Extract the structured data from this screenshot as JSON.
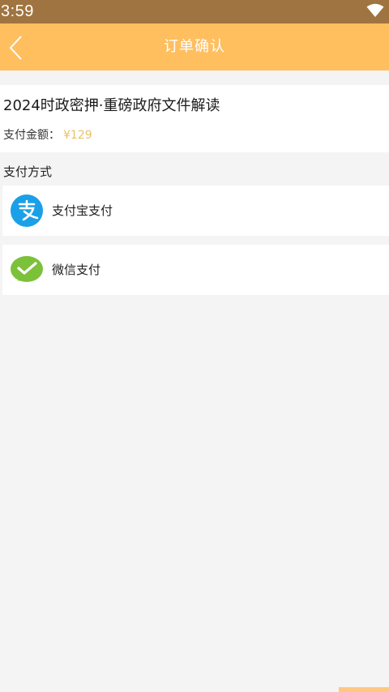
{
  "status_bar": {
    "time": "3:59",
    "wifi_icon": "wifi-icon"
  },
  "nav": {
    "title": "订单确认",
    "back_icon": "chevron-left-icon",
    "background_color": "#ffbf5f"
  },
  "order": {
    "product_title": "2024时政密押·重磅政府文件解读",
    "amount_label": "支付金额：",
    "amount_value": "¥129",
    "amount_color": "#e8c36a"
  },
  "payment": {
    "section_label": "支付方式",
    "options": [
      {
        "label": "支付宝支付",
        "icon": "alipay-icon",
        "color": "#1aa0e8"
      },
      {
        "label": "微信支付",
        "icon": "wechat-pay-icon",
        "color": "#7cc13a"
      }
    ]
  }
}
